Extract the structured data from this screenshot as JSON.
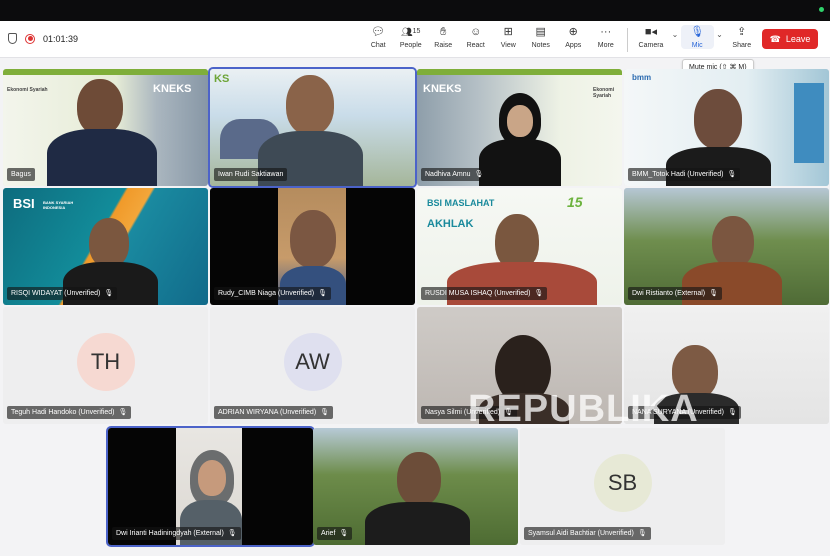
{
  "meeting": {
    "timer": "01:01:39"
  },
  "toolbar": {
    "chat": "Chat",
    "people": "People",
    "people_count": "15",
    "raise": "Raise",
    "react": "React",
    "view": "View",
    "notes": "Notes",
    "apps": "Apps",
    "more": "More",
    "camera": "Camera",
    "mic": "Mic",
    "share": "Share",
    "leave": "Leave"
  },
  "tooltip": "Mute mic (⇧ ⌘ M)",
  "watermark": "REPUBLIKA",
  "participants": [
    {
      "name": "Bagus",
      "logo": "KNEKS",
      "logo2": "Ekonomi Syariah"
    },
    {
      "name": "Iwan Rudi Saktiawan",
      "logo": "KS"
    },
    {
      "name": "Nadhiva Amnu",
      "logo": "KNEKS",
      "logo2": "Ekonomi Syariah"
    },
    {
      "name": "BMM_Totok Hadi (Unverified)",
      "logo": "bmm"
    },
    {
      "name": "RISQI WIDAYAT (Unverified)",
      "logo": "BSI",
      "logo2": "BANK SYARIAH INDONESIA"
    },
    {
      "name": "Rudy_CIMB Niaga (Unverified)"
    },
    {
      "name": "RUSDI MUSA ISHAQ (Unverified)",
      "logo": "BSI MASLAHAT",
      "logo2": "AKHLAK",
      "logo3": "15"
    },
    {
      "name": "Dwi Ristianto (External)"
    },
    {
      "name": "Teguh Hadi Handoko (Unverified)",
      "initials": "TH"
    },
    {
      "name": "ADRIAN WIRYANA (Unverified)",
      "initials": "AW"
    },
    {
      "name": "Nasya Silmi (Unverified)"
    },
    {
      "name": "NANA SURYANA (Unverified)"
    },
    {
      "name": "Dwi Irianti Hadiningdyah (External)"
    },
    {
      "name": "Arief"
    },
    {
      "name": "Syamsul Aidi Bachtiar (Unverified)",
      "initials": "SB"
    }
  ],
  "colors": {
    "leave": "#e02828",
    "selected_outline": "#4c63c9",
    "avatar_th": "#f6d9d2",
    "avatar_aw": "#dfe0ef",
    "avatar_sb": "#e7e9d6"
  }
}
